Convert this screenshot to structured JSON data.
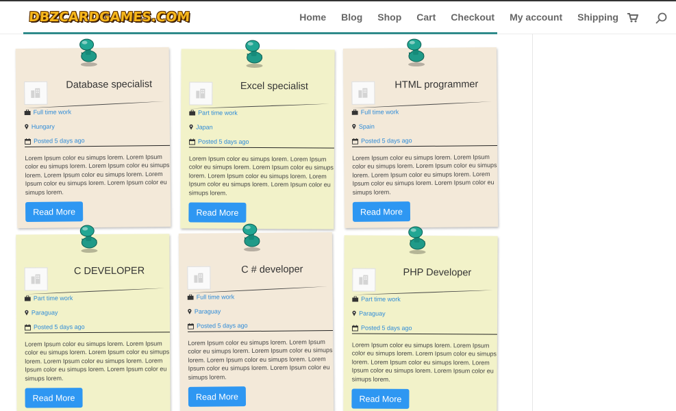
{
  "header": {
    "logo_text": "DBZCARDGAMES.COM",
    "nav": [
      {
        "label": "Home"
      },
      {
        "label": "Blog"
      },
      {
        "label": "Shop"
      },
      {
        "label": "Cart"
      },
      {
        "label": "Checkout"
      },
      {
        "label": "My account"
      },
      {
        "label": "Shipping"
      }
    ]
  },
  "colors": {
    "accent_teal": "#2f8b8b",
    "link_blue": "#2e8bd8",
    "button_blue": "#2e97f2",
    "card_beige": "#f3e9d9",
    "card_yellow": "#f2f2c9"
  },
  "icons": [
    "cart-icon",
    "search-icon",
    "pushpin-icon",
    "briefcase-icon",
    "map-marker-icon",
    "calendar-icon",
    "company-logo-placeholder-icon"
  ],
  "jobs": [
    {
      "title": "Database specialist",
      "type": "Full time work",
      "location": "Hungary",
      "posted": "Posted 5 days ago",
      "description": "Lorem Ipsum color eu simups lorem. Lorem Ipsum color eu simups lorem. Lorem Ipsum color eu simups lorem. Lorem Ipsum color eu simups lorem. Lorem Ipsum color eu simups lorem. Lorem Ipsum color eu simups lorem.",
      "button": "Read More"
    },
    {
      "title": "Excel specialist",
      "type": "Part time work",
      "location": "Japan",
      "posted": "Posted 5 days ago",
      "description": "Lorem Ipsum color eu simups lorem. Lorem Ipsum color eu simups lorem. Lorem Ipsum color eu simups lorem. Lorem Ipsum color eu simups lorem. Lorem Ipsum color eu simups lorem. Lorem Ipsum color eu simups lorem.",
      "button": "Read More"
    },
    {
      "title": "HTML programmer",
      "type": "Full time work",
      "location": "Spain",
      "posted": "Posted 5 days ago",
      "description": "Lorem Ipsum color eu simups lorem. Lorem Ipsum color eu simups lorem. Lorem Ipsum color eu simups lorem. Lorem Ipsum color eu simups lorem. Lorem Ipsum color eu simups lorem. Lorem Ipsum color eu simups lorem.",
      "button": "Read More"
    },
    {
      "title": "C DEVELOPER",
      "type": "Part time work",
      "location": "Paraguay",
      "posted": "Posted 5 days ago",
      "description": "Lorem Ipsum color eu simups lorem. Lorem Ipsum color eu simups lorem. Lorem Ipsum color eu simups lorem. Lorem Ipsum color eu simups lorem. Lorem Ipsum color eu simups lorem. Lorem Ipsum color eu simups lorem.",
      "button": "Read More"
    },
    {
      "title": "C # developer",
      "type": "Full time work",
      "location": "Paraguay",
      "posted": "Posted 5 days ago",
      "description": "Lorem Ipsum color eu simups lorem. Lorem Ipsum color eu simups lorem. Lorem Ipsum color eu simups lorem. Lorem Ipsum color eu simups lorem. Lorem Ipsum color eu simups lorem. Lorem Ipsum color eu simups lorem.",
      "button": "Read More"
    },
    {
      "title": "PHP Developer",
      "type": "Part time work",
      "location": "Paraguay",
      "posted": "Posted 5 days ago",
      "description": "Lorem Ipsum color eu simups lorem. Lorem Ipsum color eu simups lorem. Lorem Ipsum color eu simups lorem. Lorem Ipsum color eu simups lorem. Lorem Ipsum color eu simups lorem. Lorem Ipsum color eu simups lorem.",
      "button": "Read More"
    }
  ]
}
